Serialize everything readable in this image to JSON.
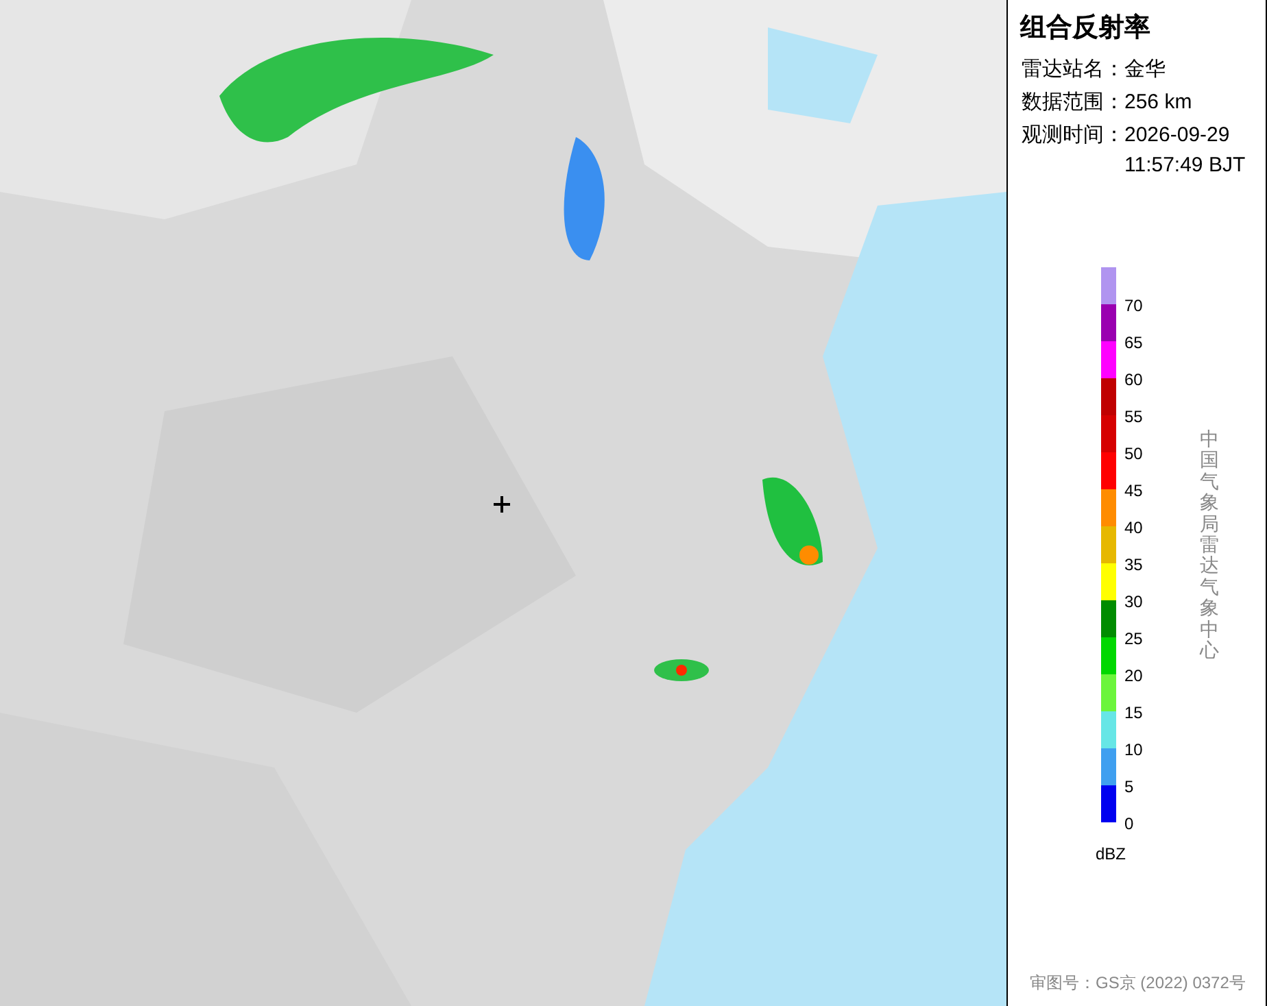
{
  "panel": {
    "title": "组合反射率",
    "info": [
      {
        "label": "雷达站名：",
        "value": "金华"
      },
      {
        "label": "数据范围：",
        "value": "256 km"
      },
      {
        "label": "观测时间：",
        "value": "2026-09-29",
        "value2": "11:57:49 BJT"
      }
    ],
    "legend": [
      {
        "color": "#b094f0",
        "label": "70"
      },
      {
        "color": "#9a00b0",
        "label": "65"
      },
      {
        "color": "#ff00ff",
        "label": "60"
      },
      {
        "color": "#c00000",
        "label": "55"
      },
      {
        "color": "#d60000",
        "label": "50"
      },
      {
        "color": "#ff0000",
        "label": "45"
      },
      {
        "color": "#ff8c00",
        "label": "40"
      },
      {
        "color": "#e6b800",
        "label": "35"
      },
      {
        "color": "#ffff00",
        "label": "30"
      },
      {
        "color": "#008c00",
        "label": "25"
      },
      {
        "color": "#00d800",
        "label": "20"
      },
      {
        "color": "#6cf53c",
        "label": "15"
      },
      {
        "color": "#66e6e6",
        "label": "10"
      },
      {
        "color": "#3f9ff0",
        "label": "5"
      },
      {
        "color": "#0000f0",
        "label": "0"
      }
    ],
    "unit": "dBZ",
    "source": "中国气象局雷达气象中心",
    "footer": "审图号：GS京 (2022) 0372号"
  }
}
